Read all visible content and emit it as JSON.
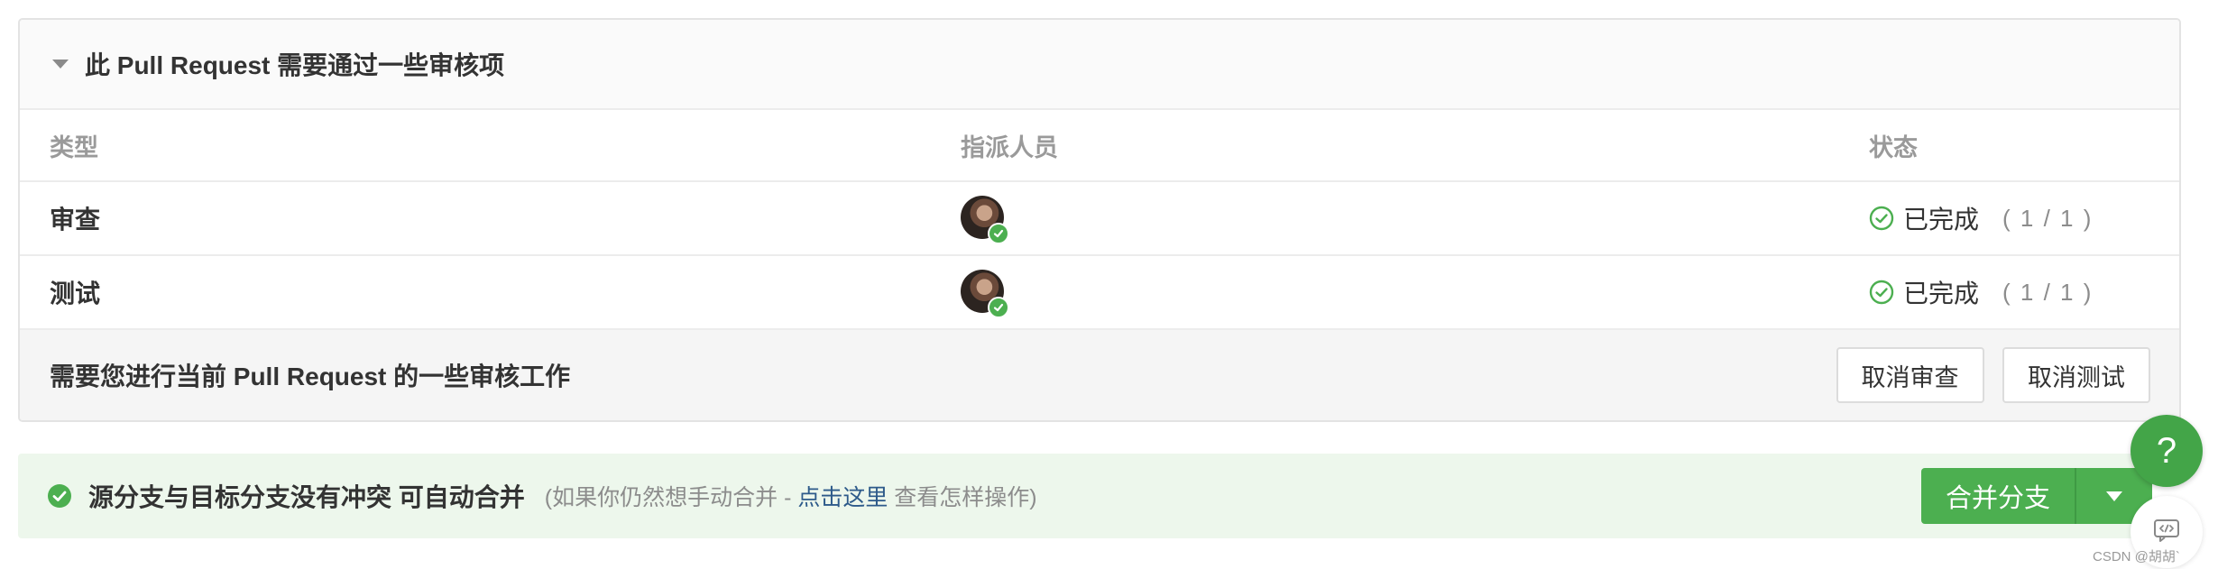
{
  "review": {
    "title": "此 Pull Request 需要通过一些审核项",
    "columns": {
      "type": "类型",
      "assignee": "指派人员",
      "status": "状态"
    },
    "rows": [
      {
        "type": "审查",
        "status_text": "已完成",
        "status_count": "( 1 / 1 )"
      },
      {
        "type": "测试",
        "status_text": "已完成",
        "status_count": "( 1 / 1 )"
      }
    ],
    "action_text": "需要您进行当前 Pull Request 的一些审核工作",
    "cancel_review_label": "取消审查",
    "cancel_test_label": "取消测试"
  },
  "merge": {
    "title": "源分支与目标分支没有冲突 可自动合并",
    "hint_prefix": "(如果你仍然想手动合并 - ",
    "hint_link": "点击这里",
    "hint_suffix": " 查看怎样操作)",
    "button_label": "合并分支"
  },
  "help": {
    "label": "?"
  },
  "watermark": "CSDN @胡胡`",
  "colors": {
    "success": "#4caf50",
    "link": "#2d5a8a",
    "muted": "#8c8c8c"
  }
}
